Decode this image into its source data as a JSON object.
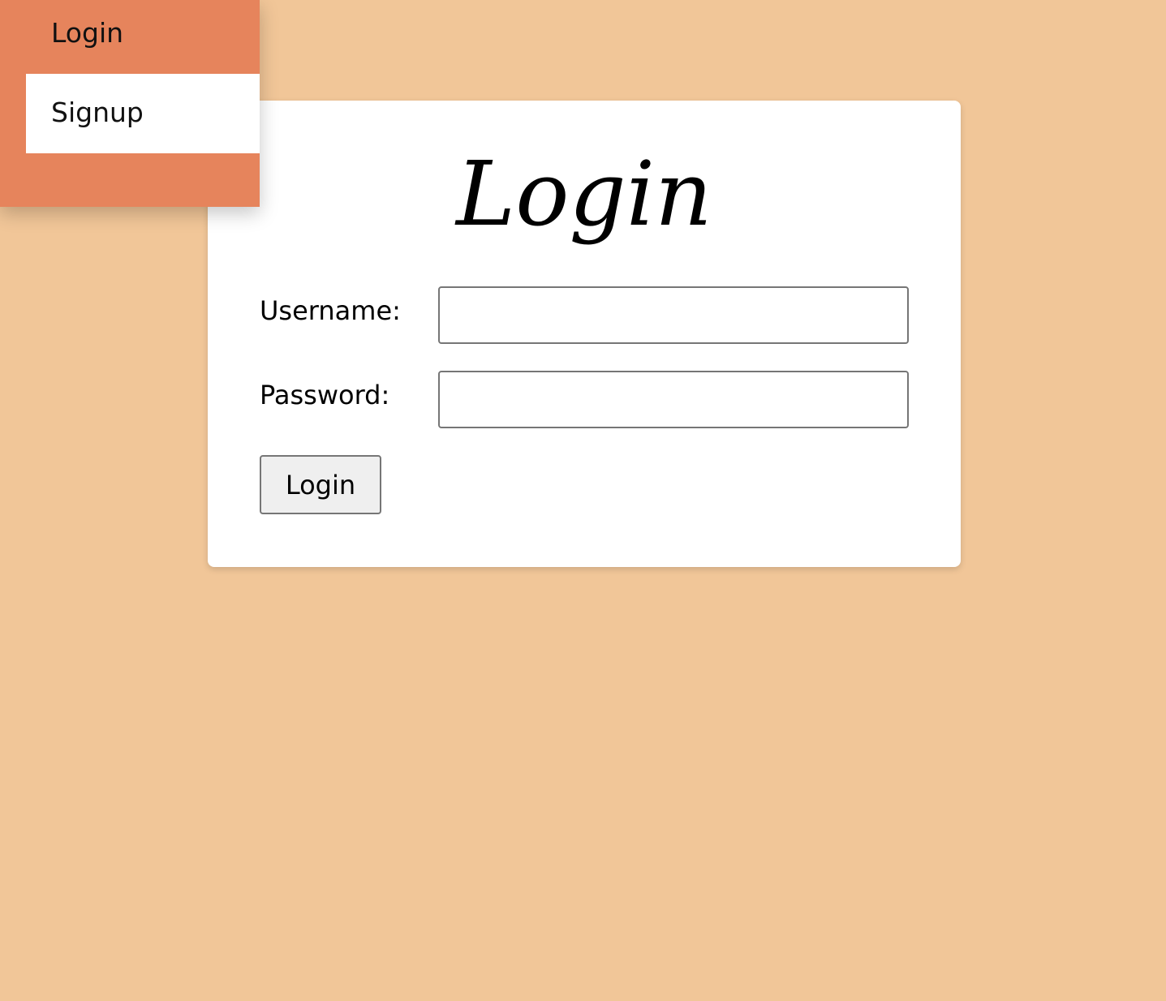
{
  "nav": {
    "items": [
      {
        "label": "Login"
      },
      {
        "label": "Signup"
      }
    ]
  },
  "card": {
    "title": "Login",
    "username_label": "Username:",
    "username_value": "",
    "password_label": "Password:",
    "password_value": "",
    "submit_label": "Login"
  },
  "colors": {
    "page_background": "#f1c698",
    "nav_background": "#e6845c",
    "nav_active_background": "#ffffff",
    "card_background": "#ffffff"
  }
}
